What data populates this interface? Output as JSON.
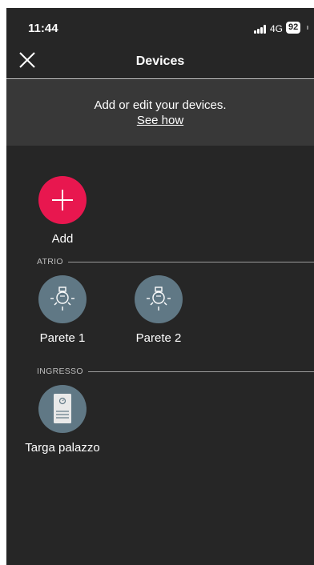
{
  "status_bar": {
    "time": "11:44",
    "network": "4G",
    "battery": "92"
  },
  "nav": {
    "title": "Devices",
    "close_icon": "close-icon"
  },
  "banner": {
    "text": "Add or edit your devices.",
    "link": "See how"
  },
  "add_tile": {
    "label": "Add",
    "icon": "plus-icon",
    "color": "#e8174f"
  },
  "sections": [
    {
      "title": "ATRIO",
      "devices": [
        {
          "label": "Parete 1",
          "icon": "lamp-icon"
        },
        {
          "label": "Parete 2",
          "icon": "lamp-icon"
        }
      ]
    },
    {
      "title": "INGRESSO",
      "devices": [
        {
          "label": "Targa palazzo",
          "icon": "entrance-panel-icon"
        }
      ]
    }
  ],
  "colors": {
    "background": "#262626",
    "banner": "#383838",
    "device_circle": "#607885",
    "accent": "#e8174f"
  }
}
